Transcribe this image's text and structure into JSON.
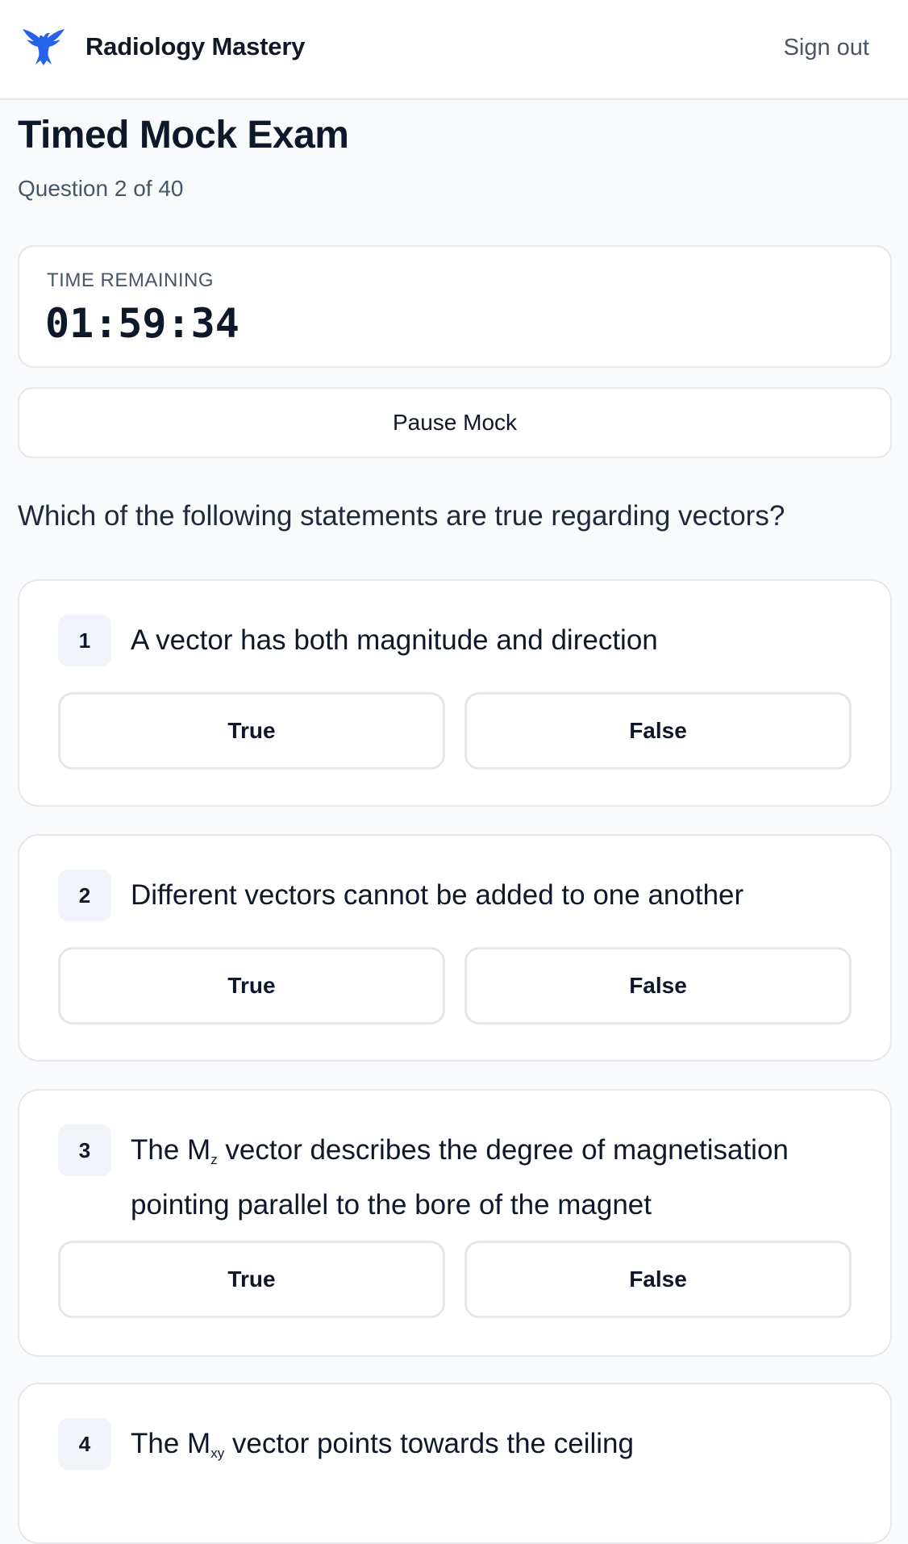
{
  "header": {
    "brand": "Radiology Mastery",
    "logo_icon": "eagle-logo-icon",
    "sign_out": "Sign out"
  },
  "exam": {
    "title": "Timed Mock Exam",
    "progress": "Question 2 of 40",
    "timer_label": "TIME REMAINING",
    "timer_value": "01:59:34",
    "pause_label": "Pause Mock",
    "question": "Which of the following statements are true regarding vectors?"
  },
  "statements": [
    {
      "number": "1",
      "text": "A vector has both magnitude and direction",
      "true_label": "True",
      "false_label": "False"
    },
    {
      "number": "2",
      "text": "Different vectors cannot be added to one another",
      "true_label": "True",
      "false_label": "False"
    },
    {
      "number": "3",
      "text_pre": "The M",
      "text_sub": "z",
      "text_post": " vector describes the degree of magnetisation pointing parallel to the bore of the magnet",
      "true_label": "True",
      "false_label": "False"
    },
    {
      "number": "4",
      "text_pre": "The M",
      "text_sub": "xy",
      "text_post": " vector points towards the ceiling"
    }
  ],
  "colors": {
    "brand_blue": "#1d4ed8",
    "background": "#f8fafc",
    "border": "#e5e7eb"
  }
}
